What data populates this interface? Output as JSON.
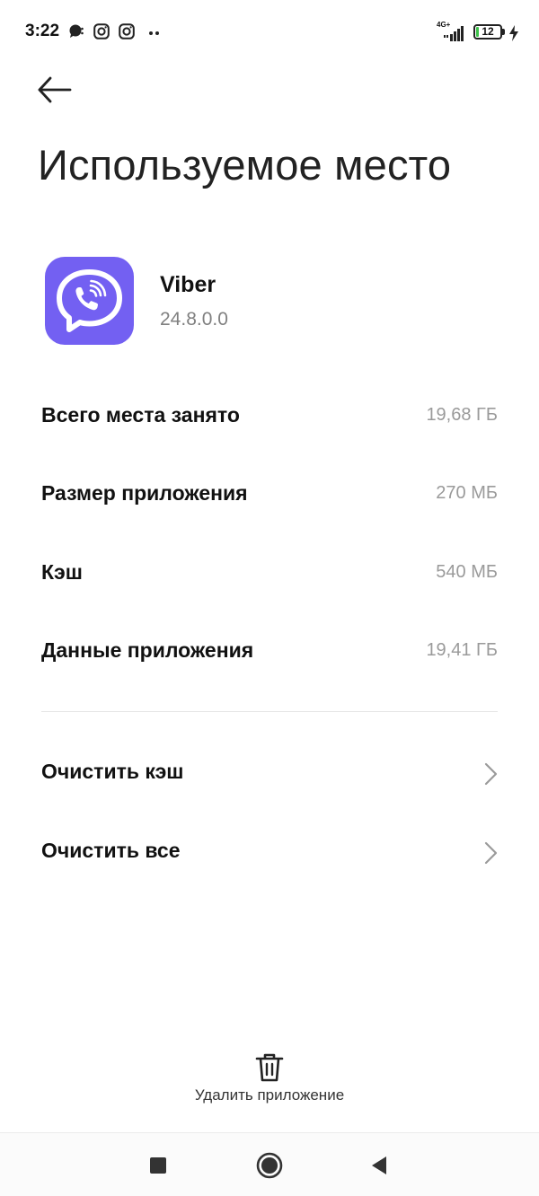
{
  "status_bar": {
    "time": "3:22",
    "network": "4G+",
    "battery_level": "12",
    "battery_fraction": 0.12,
    "battery_fill_color": "#3ec34a",
    "left_icons": [
      "chat-notification-icon",
      "instagram-icon",
      "instagram-icon",
      "more-notifications-icon"
    ],
    "right_icons": [
      "signal-icon",
      "battery-icon",
      "charging-icon"
    ]
  },
  "header": {
    "back_icon": "arrow-left-icon",
    "title": "Используемое место"
  },
  "app": {
    "name": "Viber",
    "version": "24.8.0.0",
    "icon": "viber-icon",
    "icon_color": "#7360f2"
  },
  "storage": {
    "total_label": "Всего места занято",
    "total_value": "19,68 ГБ",
    "app_size_label": "Размер приложения",
    "app_size_value": "270 МБ",
    "cache_label": "Кэш",
    "cache_value": "540 МБ",
    "data_label": "Данные приложения",
    "data_value": "19,41 ГБ"
  },
  "actions": {
    "clear_cache": "Очистить кэш",
    "clear_all": "Очистить все"
  },
  "uninstall": {
    "label": "Удалить приложение",
    "icon": "trash-icon"
  },
  "nav": {
    "recents_icon": "square-icon",
    "home_icon": "circle-icon",
    "back_icon": "triangle-back-icon"
  }
}
